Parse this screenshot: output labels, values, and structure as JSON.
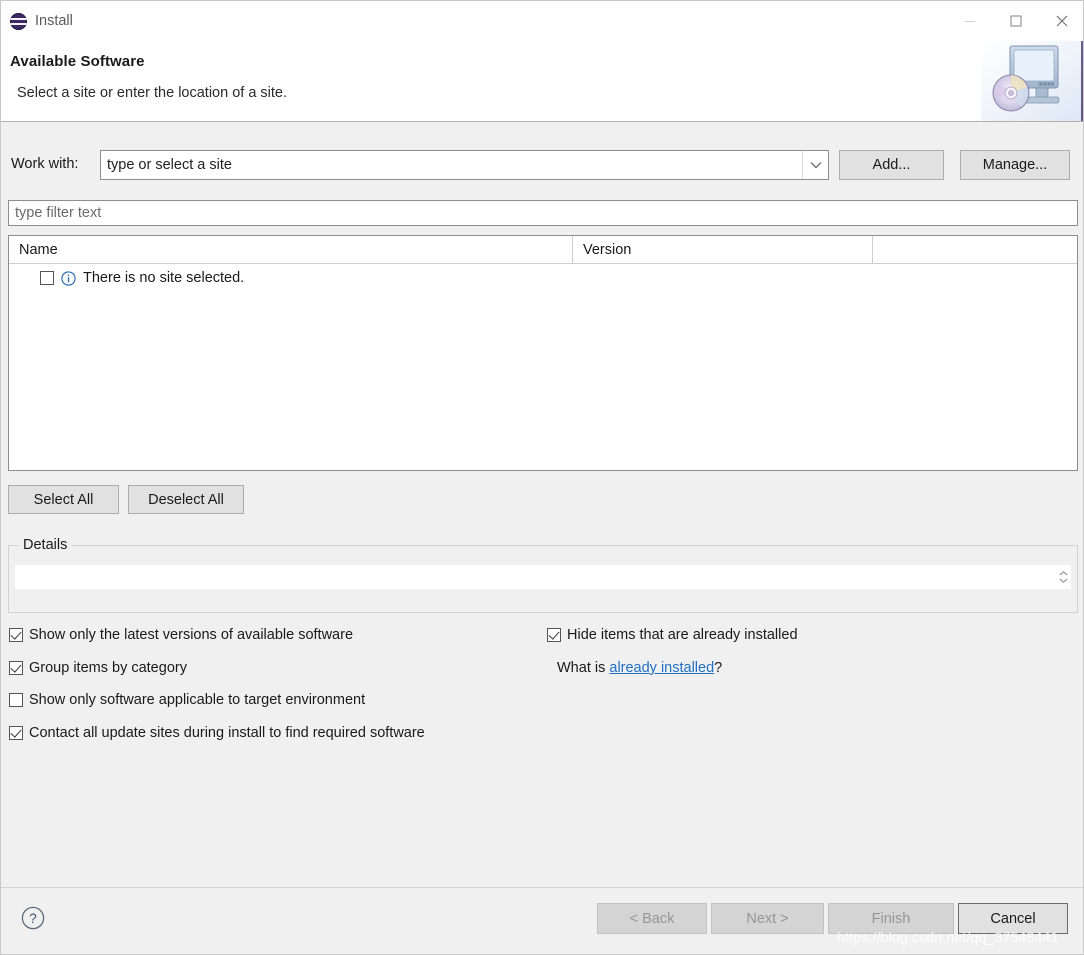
{
  "window": {
    "title": "Install",
    "icon": "eclipse-icon",
    "controls": {
      "minimize": "minimize-icon",
      "maximize": "maximize-icon",
      "close": "close-icon"
    }
  },
  "banner": {
    "title": "Available Software",
    "subtitle": "Select a site or enter the location of a site.",
    "artwork": "computer-disc-icon"
  },
  "work_with": {
    "label": "Work with:",
    "value": "type or select a site",
    "placeholder": "type or select a site",
    "add_label": "Add...",
    "manage_label": "Manage..."
  },
  "filter": {
    "placeholder": "type filter text",
    "value": ""
  },
  "table": {
    "columns": [
      "Name",
      "Version",
      ""
    ],
    "rows": [
      {
        "checked": false,
        "icon": "info-icon",
        "name": "There is no site selected.",
        "version": ""
      }
    ]
  },
  "selection_buttons": {
    "select_all": "Select All",
    "deselect_all": "Deselect All"
  },
  "details": {
    "legend": "Details",
    "value": ""
  },
  "options": {
    "left": [
      {
        "label": "Show only the latest versions of available software",
        "checked": true
      },
      {
        "label": "Group items by category",
        "checked": true
      },
      {
        "label": "Show only software applicable to target environment",
        "checked": false
      },
      {
        "label": "Contact all update sites during install to find required software",
        "checked": true
      }
    ],
    "right": [
      {
        "label": "Hide items that are already installed",
        "checked": true
      }
    ],
    "whatis_prefix": "What is ",
    "whatis_link": "already installed",
    "whatis_suffix": "?"
  },
  "footer": {
    "help_icon": "help-icon",
    "back_label": "< Back",
    "next_label": "Next >",
    "finish_label": "Finish",
    "cancel_label": "Cancel",
    "back_enabled": false,
    "next_enabled": false,
    "finish_enabled": false,
    "cancel_enabled": true
  },
  "watermark": "https://blog.csdn.net/qq_37548441",
  "colors": {
    "link": "#1f6fc4",
    "info": "#2b6cb0",
    "banner_bg": "#ffffff",
    "body_bg": "#f0f0f0",
    "button_bg": "#e1e1e1"
  }
}
